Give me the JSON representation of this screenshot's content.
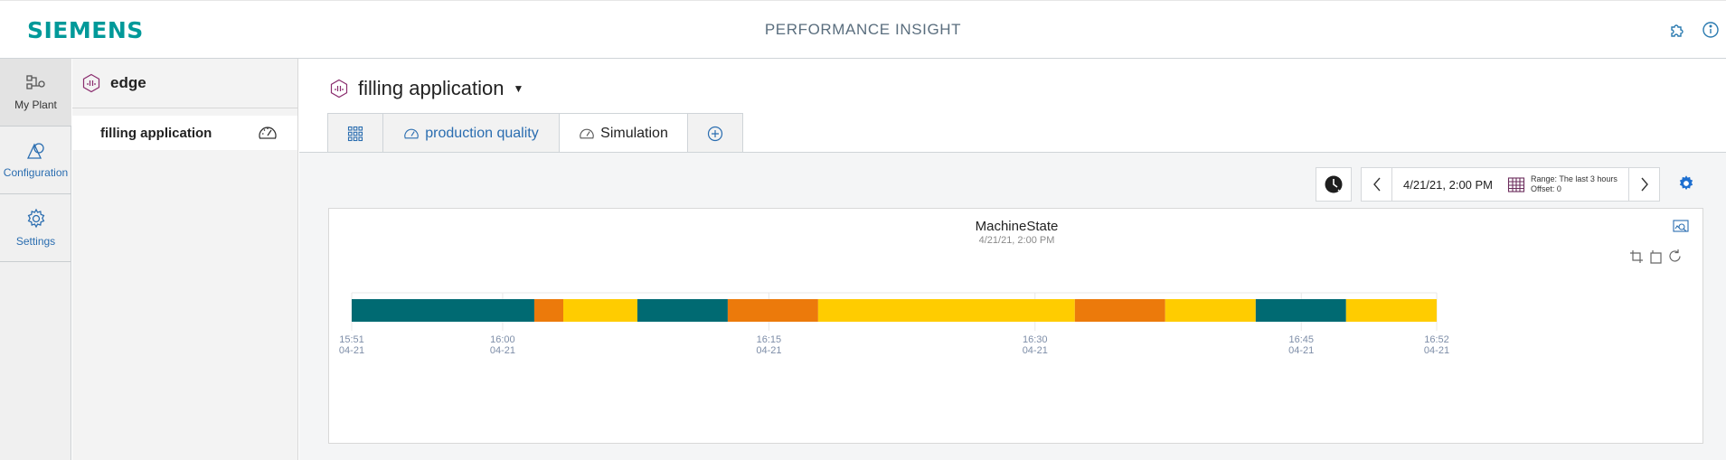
{
  "header": {
    "logo": "SIEMENS",
    "app_title": "PERFORMANCE INSIGHT"
  },
  "top_icons": [
    "puzzle-icon",
    "info-icon"
  ],
  "rail": [
    {
      "label": "My Plant",
      "icon": "plant-icon"
    },
    {
      "label": "Configuration",
      "icon": "configuration-icon"
    },
    {
      "label": "Settings",
      "icon": "settings-icon"
    }
  ],
  "tree": {
    "root": "edge",
    "items": [
      {
        "label": "filling application"
      }
    ]
  },
  "main": {
    "title": "filling application",
    "tabs": [
      {
        "label": "",
        "icon": "grid-icon"
      },
      {
        "label": "production quality",
        "icon": "gauge-icon"
      },
      {
        "label": "Simulation",
        "icon": "gauge-icon"
      },
      {
        "label": "",
        "icon": "add-icon"
      }
    ]
  },
  "toolbar": {
    "date": "4/21/21, 2:00 PM",
    "range": "Range: The last 3 hours",
    "offset": "Offset: 0"
  },
  "colors": {
    "teal": "#006a72",
    "orange": "#ec7a0b",
    "yellow": "#ffcc00",
    "accent": "#2a7ab0",
    "brand": "#009999"
  },
  "chart_data": {
    "type": "timeline",
    "title": "MachineState",
    "subtitle": "4/21/21, 2:00 PM",
    "x_range": [
      "15:51",
      "15:52"
    ],
    "ticks": [
      {
        "time": "15:51",
        "date": "04-21",
        "frac": 0
      },
      {
        "time": "16:00",
        "date": "04-21",
        "frac": 0.1391
      },
      {
        "time": "16:15",
        "date": "04-21",
        "frac": 0.3845
      },
      {
        "time": "16:30",
        "date": "04-21",
        "frac": 0.6298
      },
      {
        "time": "16:45",
        "date": "04-21",
        "frac": 0.8752
      },
      {
        "time": "16:52",
        "date": "04-21",
        "frac": 1
      }
    ],
    "segments": [
      {
        "state": "teal",
        "start": 0,
        "end": 0.1683
      },
      {
        "state": "orange",
        "start": 0.1683,
        "end": 0.195
      },
      {
        "state": "yellow",
        "start": 0.195,
        "end": 0.2633
      },
      {
        "state": "teal",
        "start": 0.2633,
        "end": 0.3466
      },
      {
        "state": "orange",
        "start": 0.3466,
        "end": 0.4299
      },
      {
        "state": "yellow",
        "start": 0.4299,
        "end": 0.6665
      },
      {
        "state": "orange",
        "start": 0.6665,
        "end": 0.7498
      },
      {
        "state": "yellow",
        "start": 0.7498,
        "end": 0.8332
      },
      {
        "state": "teal",
        "start": 0.8332,
        "end": 0.9165
      },
      {
        "state": "yellow",
        "start": 0.9165,
        "end": 1
      }
    ]
  }
}
